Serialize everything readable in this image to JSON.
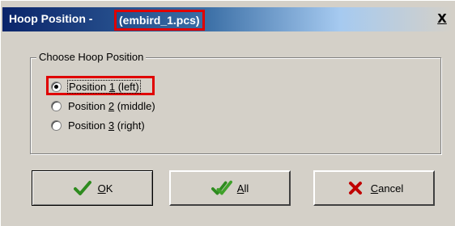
{
  "window": {
    "title_prefix": "Hoop Position - ",
    "title_file": "(embird_1.pcs)",
    "close_label": "X"
  },
  "group": {
    "label": "Choose Hoop Position",
    "options": [
      {
        "pre": "Position ",
        "key": "1",
        "post": " (left)",
        "selected": true
      },
      {
        "pre": "Position ",
        "key": "2",
        "post": " (middle)",
        "selected": false
      },
      {
        "pre": "Position ",
        "key": "3",
        "post": " (right)",
        "selected": false
      }
    ]
  },
  "buttons": {
    "ok": {
      "key": "O",
      "rest": "K"
    },
    "all": {
      "key": "A",
      "rest": "ll"
    },
    "cancel": {
      "key": "C",
      "rest": "ancel"
    }
  },
  "colors": {
    "highlight": "#e00000",
    "check_green": "#2e8b1f",
    "cancel_red": "#c00000",
    "titlebar": "#0a246a"
  },
  "icons": {
    "ok": "green-check-icon",
    "all": "double-green-check-icon",
    "cancel": "red-x-icon"
  }
}
